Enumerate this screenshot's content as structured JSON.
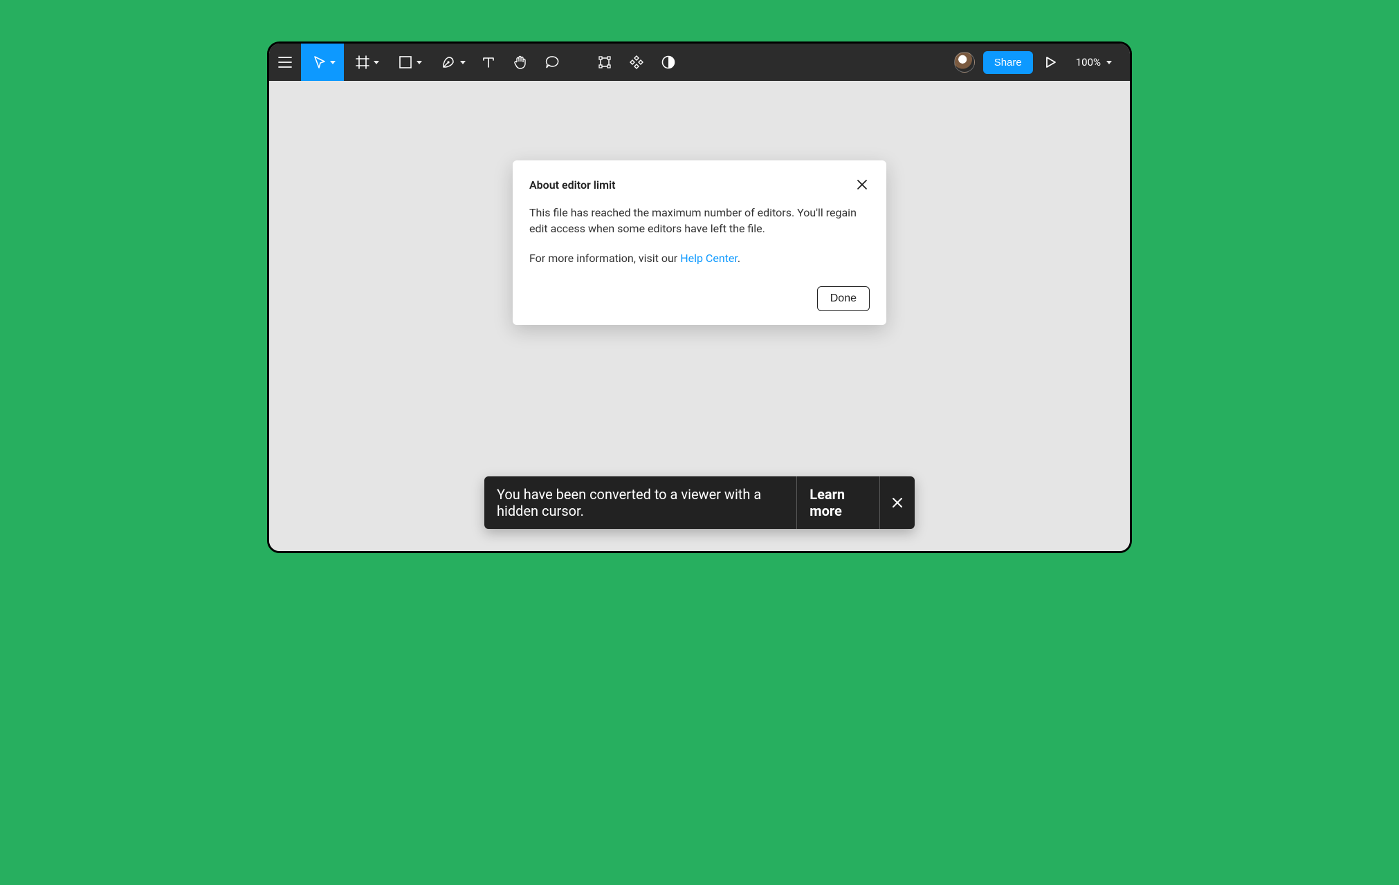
{
  "toolbar": {
    "share_label": "Share",
    "zoom_label": "100%"
  },
  "modal": {
    "title": "About editor limit",
    "body_main": "This file has reached the maximum number of editors. You'll regain edit access when some editors have left the file.",
    "body_prefix": "For more information, visit our ",
    "help_link_label": "Help Center",
    "body_suffix": ".",
    "done_label": "Done"
  },
  "toast": {
    "message": "You have been converted to a viewer with a hidden cursor.",
    "learn_more_label": "Learn more"
  }
}
